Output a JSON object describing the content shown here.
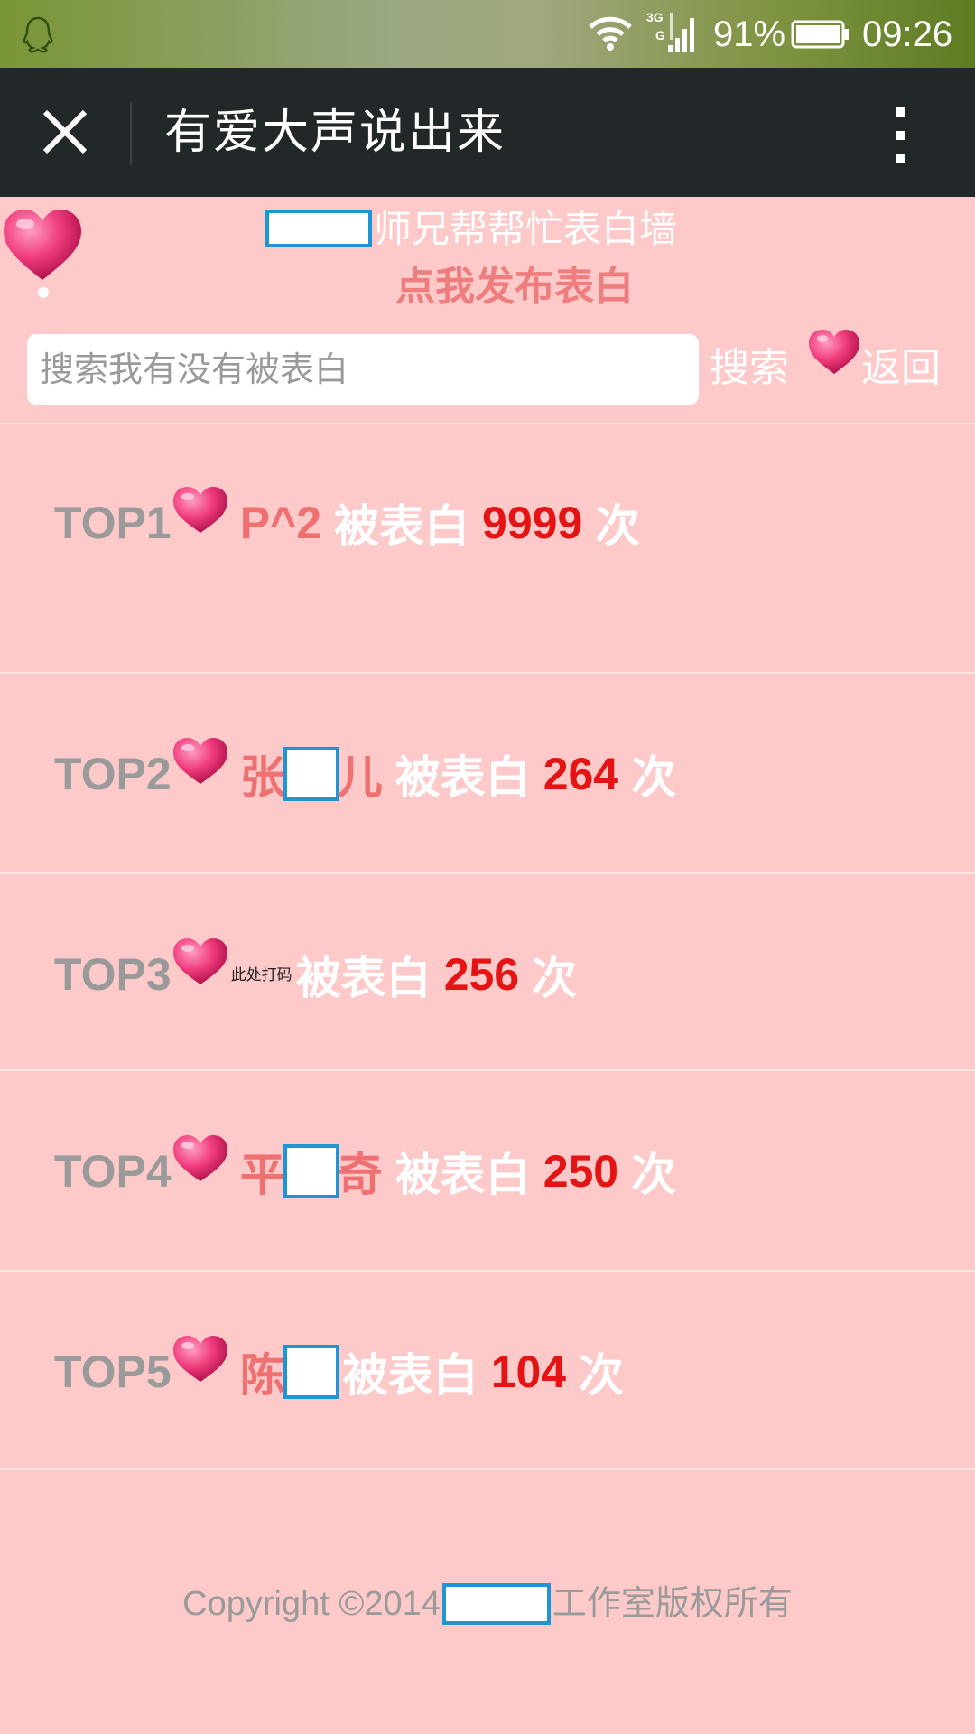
{
  "status_bar": {
    "network": "3G",
    "battery_percent": "91%",
    "time": "09:26",
    "icons": [
      "qq-icon",
      "wifi-icon",
      "signal-icon",
      "battery-icon"
    ]
  },
  "title_bar": {
    "title": "有爱大声说出来",
    "close_icon": "close-icon",
    "more_icon": "more-vertical-icon"
  },
  "header": {
    "wall_title": "师兄帮帮忙表白墙",
    "publish_link": "点我发布表白",
    "search_placeholder": "搜索我有没有被表白",
    "search_value": "",
    "search_button": "搜索",
    "back_button": "返回"
  },
  "rankings": [
    {
      "rank": "TOP1",
      "name_parts": [
        "P^2"
      ],
      "masked": false,
      "verb": "被表白",
      "count": "9999",
      "unit": "次"
    },
    {
      "rank": "TOP2",
      "name_parts": [
        "张",
        "儿"
      ],
      "masked": true,
      "verb": "被表白",
      "count": "264",
      "unit": "次"
    },
    {
      "rank": "TOP3",
      "note": "此处打码",
      "verb": "被表白",
      "count": "256",
      "unit": "次"
    },
    {
      "rank": "TOP4",
      "name_parts": [
        "平",
        "奇"
      ],
      "masked": true,
      "verb": "被表白",
      "count": "250",
      "unit": "次"
    },
    {
      "rank": "TOP5",
      "name_parts": [
        "陈",
        ""
      ],
      "masked": true,
      "verb": "被表白",
      "count": "104",
      "unit": "次"
    }
  ],
  "footer": {
    "copyright_prefix": "Copyright ©2014",
    "copyright_suffix": "工作室版权所有"
  },
  "colors": {
    "page_background": "#fec9c9",
    "title_bar": "#222829",
    "rank_label": "#9a9a9a",
    "name": "#ee7070",
    "count": "#e51414",
    "mask_border": "#1e96d6"
  }
}
